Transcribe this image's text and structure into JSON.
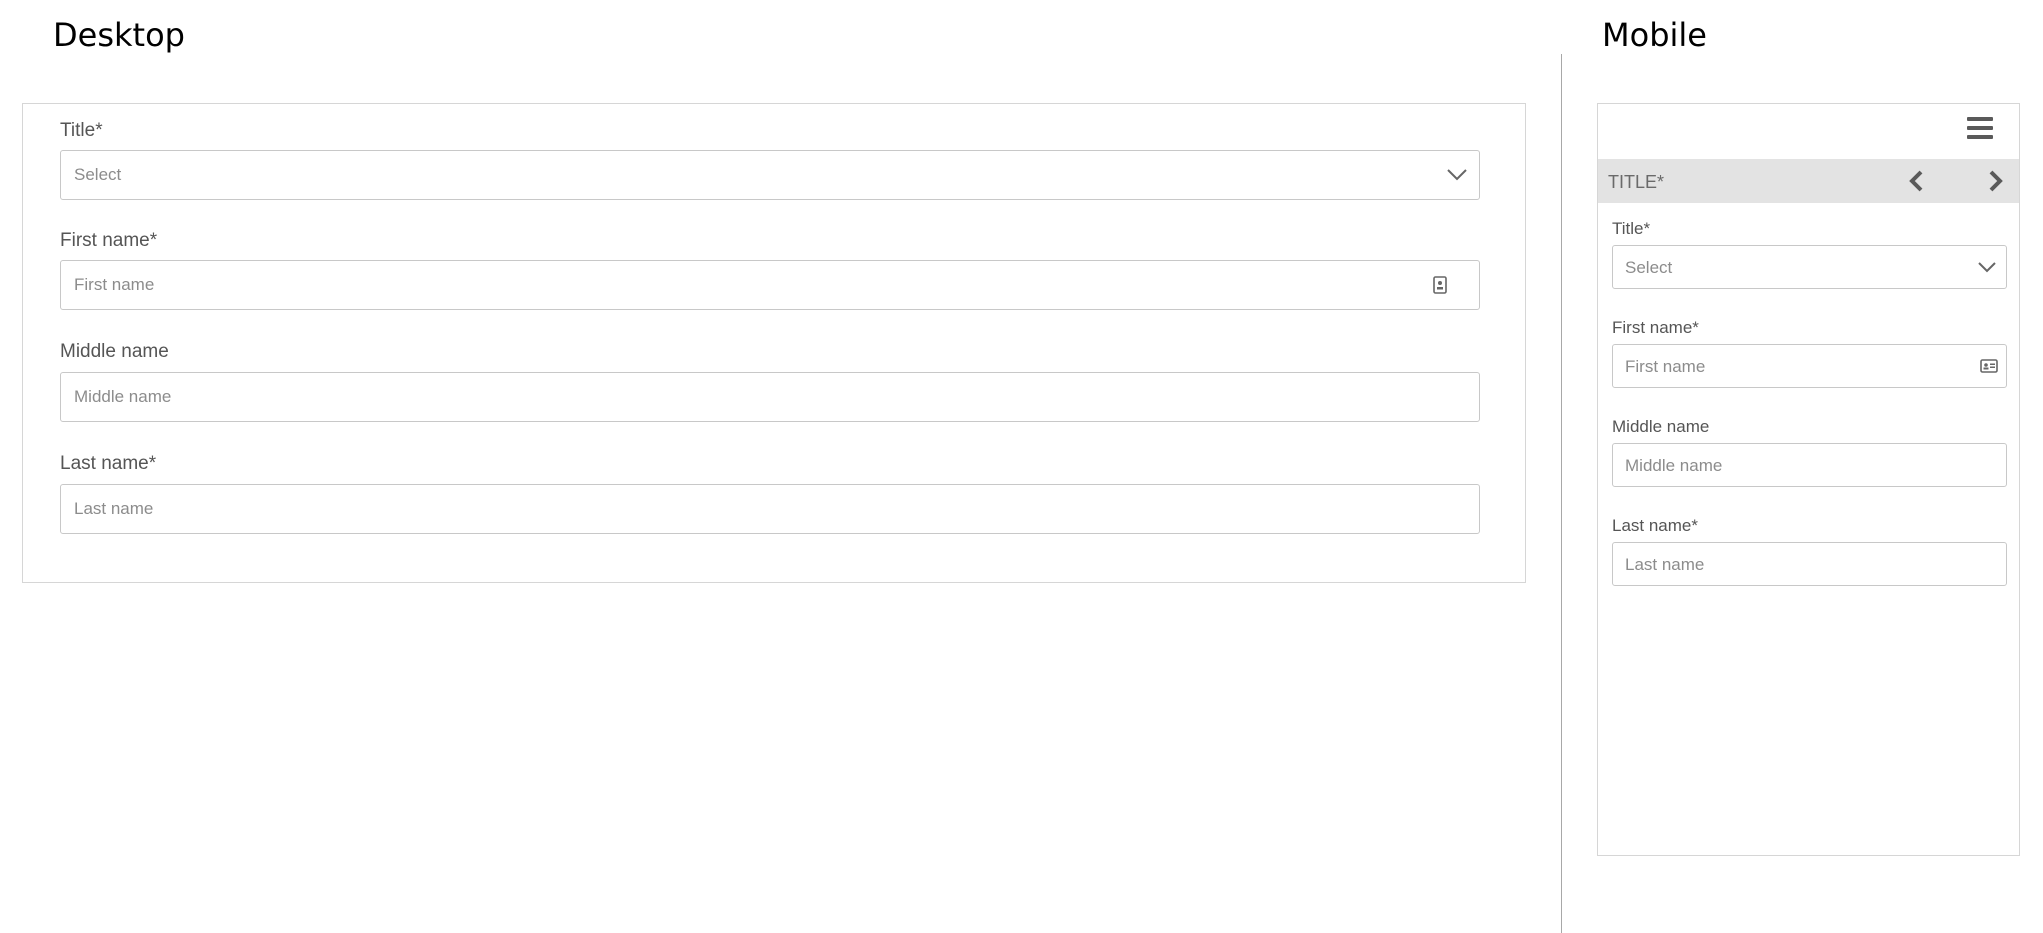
{
  "labels": {
    "desktop": "Desktop",
    "mobile": "Mobile"
  },
  "desktop": {
    "title": {
      "label": "Title*",
      "placeholder": "Select"
    },
    "first_name": {
      "label": "First name*",
      "placeholder": "First name"
    },
    "middle_name": {
      "label": "Middle name",
      "placeholder": "Middle name"
    },
    "last_name": {
      "label": "Last name*",
      "placeholder": "Last name"
    }
  },
  "mobile": {
    "step_title": "TITLE*",
    "title": {
      "label": "Title*",
      "placeholder": "Select"
    },
    "first_name": {
      "label": "First name*",
      "placeholder": "First name"
    },
    "middle_name": {
      "label": "Middle name",
      "placeholder": "Middle name"
    },
    "last_name": {
      "label": "Last name*",
      "placeholder": "Last name"
    }
  },
  "icons": {
    "chevron": "chevron-down-icon",
    "contact_card": "contact-card-icon",
    "hamburger": "hamburger-menu-icon",
    "prev": "chevron-left-icon",
    "next": "chevron-right-icon"
  },
  "colors": {
    "border": "#c8c8c8",
    "label": "#555555",
    "placeholder": "#8c8c8c",
    "stepbar": "#e3e3e3"
  }
}
